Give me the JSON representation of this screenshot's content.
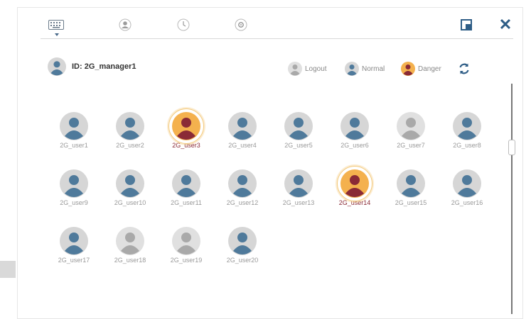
{
  "colors": {
    "normal_bg": "#d6d6d6",
    "normal_fg": "#4f7a9b",
    "logout_bg": "#e0e0e0",
    "logout_fg": "#a9a9a9",
    "danger_bg": "#f4b14e",
    "danger_fg": "#8a2a36",
    "accent": "#2e5d86"
  },
  "toolbar": {
    "tabs": [
      {
        "icon": "keyboard-icon"
      },
      {
        "icon": "user-icon"
      },
      {
        "icon": "clock-icon"
      },
      {
        "icon": "gear-icon"
      }
    ],
    "window_icon": "window-icon",
    "close_icon": "close-icon",
    "close_glyph": "✕"
  },
  "manager": {
    "label": "ID: 2G_manager1"
  },
  "legend": {
    "logout": "Logout",
    "normal": "Normal",
    "danger": "Danger",
    "refresh_icon": "refresh-icon"
  },
  "users": [
    {
      "name": "2G_user1",
      "status": "normal"
    },
    {
      "name": "2G_user2",
      "status": "normal"
    },
    {
      "name": "2G_user3",
      "status": "danger"
    },
    {
      "name": "2G_user4",
      "status": "normal"
    },
    {
      "name": "2G_user5",
      "status": "normal"
    },
    {
      "name": "2G_user6",
      "status": "normal"
    },
    {
      "name": "2G_user7",
      "status": "logout"
    },
    {
      "name": "2G_user8",
      "status": "normal"
    },
    {
      "name": "2G_user9",
      "status": "normal"
    },
    {
      "name": "2G_user10",
      "status": "normal"
    },
    {
      "name": "2G_user11",
      "status": "normal"
    },
    {
      "name": "2G_user12",
      "status": "normal"
    },
    {
      "name": "2G_user13",
      "status": "normal"
    },
    {
      "name": "2G_user14",
      "status": "danger"
    },
    {
      "name": "2G_user15",
      "status": "normal"
    },
    {
      "name": "2G_user16",
      "status": "normal"
    },
    {
      "name": "2G_user17",
      "status": "normal"
    },
    {
      "name": "2G_user18",
      "status": "logout"
    },
    {
      "name": "2G_user19",
      "status": "logout"
    },
    {
      "name": "2G_user20",
      "status": "normal"
    }
  ]
}
